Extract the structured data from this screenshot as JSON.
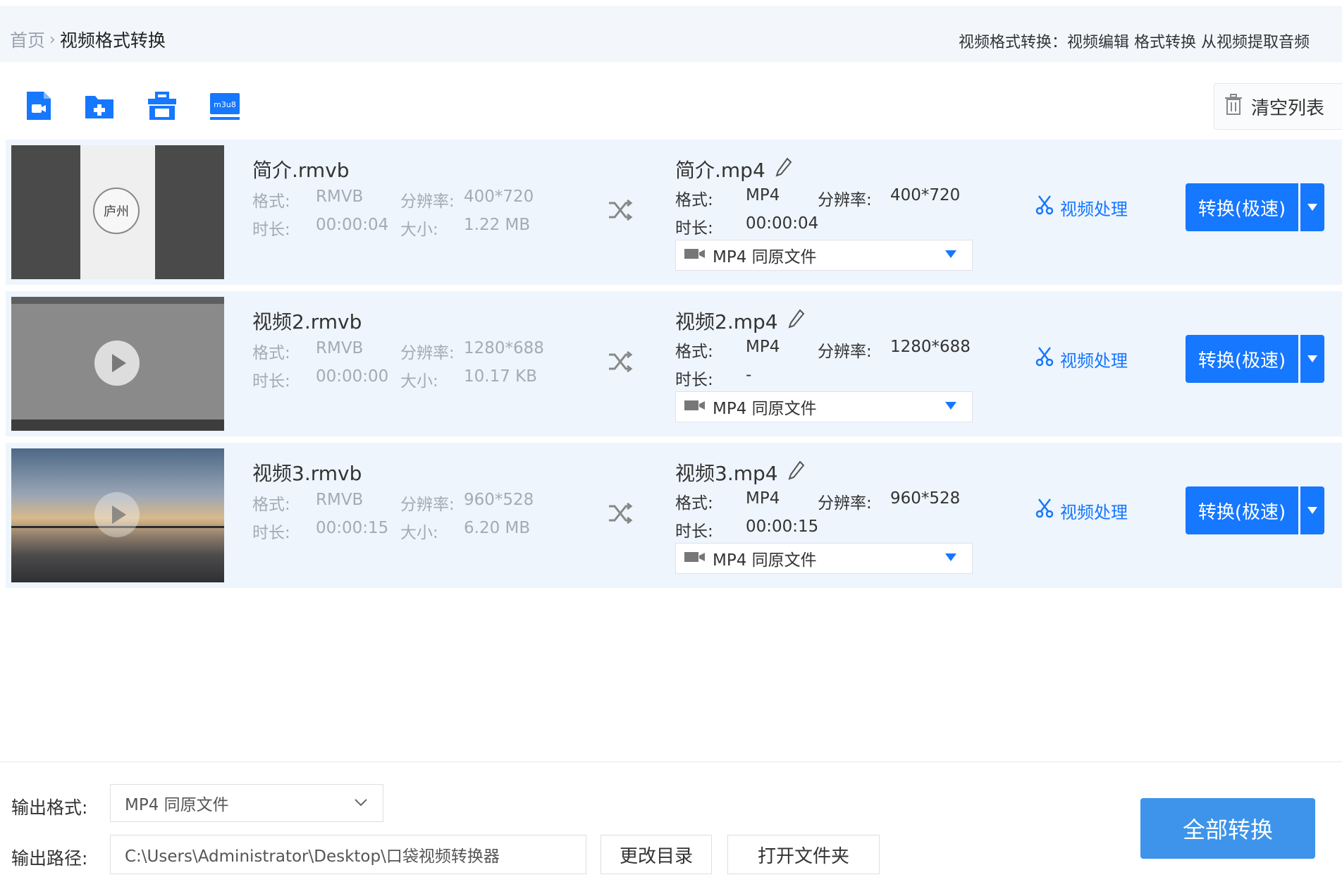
{
  "header": {
    "breadcrumb_home": "首页",
    "breadcrumb_separator": "›",
    "breadcrumb_current": "视频格式转换",
    "tagline": "视频格式转换：视频编辑 格式转换 从视频提取音频"
  },
  "toolbar": {
    "tools": [
      "add-video-icon",
      "add-folder-icon",
      "toolbox-icon",
      "m3u8-icon"
    ],
    "m3u8_label": "m3u8",
    "clear_label": "清空列表"
  },
  "labels": {
    "format": "格式:",
    "resolution": "分辨率:",
    "duration": "时长:",
    "size": "大小:",
    "process": "视频处理",
    "convert": "转换(极速)"
  },
  "files": [
    {
      "source_name": "简介.rmvb",
      "source_format": "RMVB",
      "source_resolution": "400*720",
      "source_duration": "00:00:04",
      "source_size": "1.22 MB",
      "thumb_watermark": "庐州",
      "target_name": "简介.mp4",
      "target_format": "MP4",
      "target_resolution": "400*720",
      "target_duration": "00:00:04",
      "preset": "MP4  同原文件"
    },
    {
      "source_name": "视频2.rmvb",
      "source_format": "RMVB",
      "source_resolution": "1280*688",
      "source_duration": "00:00:00",
      "source_size": "10.17 KB",
      "target_name": "视频2.mp4",
      "target_format": "MP4",
      "target_resolution": "1280*688",
      "target_duration": "-",
      "preset": "MP4  同原文件"
    },
    {
      "source_name": "视频3.rmvb",
      "source_format": "RMVB",
      "source_resolution": "960*528",
      "source_duration": "00:00:15",
      "source_size": "6.20 MB",
      "target_name": "视频3.mp4",
      "target_format": "MP4",
      "target_resolution": "960*528",
      "target_duration": "00:00:15",
      "preset": "MP4  同原文件"
    }
  ],
  "footer": {
    "output_format_label": "输出格式:",
    "output_format_value": "MP4  同原文件",
    "output_path_label": "输出路径:",
    "output_path_value": "C:\\Users\\Administrator\\Desktop\\口袋视频转换器",
    "change_dir_label": "更改目录",
    "open_folder_label": "打开文件夹",
    "convert_all_label": "全部转换"
  },
  "colors": {
    "accent": "#1677ff",
    "row_background": "#eef5fd",
    "header_background": "#f3f7fc",
    "convert_all": "#3d94ea"
  }
}
